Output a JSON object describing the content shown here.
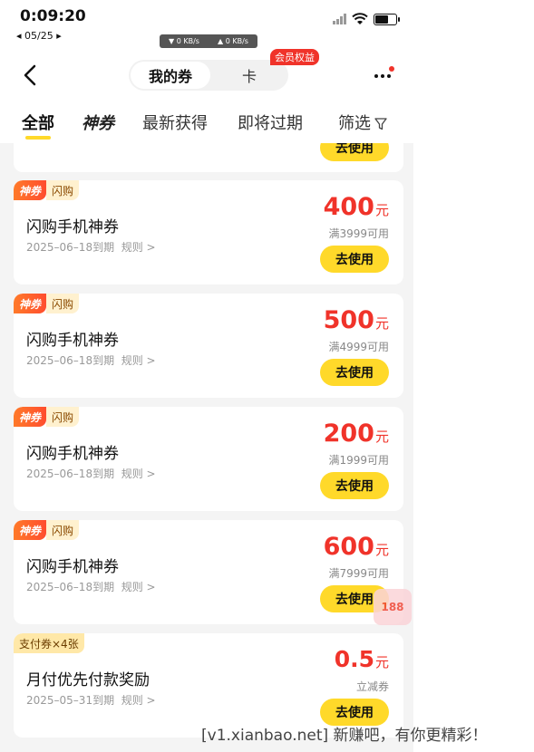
{
  "status_bar": {
    "time": "0:09:20",
    "back_app": "◂ 05/25 ▸",
    "net_down": "▼ 0 KB/s",
    "net_up": "▲ 0 KB/s"
  },
  "nav": {
    "tab_coupons": "我的券",
    "tab_cards": "卡",
    "member_badge": "会员权益"
  },
  "tabs": {
    "all": "全部",
    "shen": "神券",
    "latest": "最新获得",
    "expiring": "即将过期",
    "filter": "筛选"
  },
  "cards": [
    {
      "btn": "去使用"
    },
    {
      "tag1": "神券",
      "tag2": "闪购",
      "title": "闪购手机神券",
      "expiry": "2025–06–18到期",
      "rule": "规则 >",
      "amount": "400",
      "unit": "元",
      "cond": "满3999可用",
      "btn": "去使用"
    },
    {
      "tag1": "神券",
      "tag2": "闪购",
      "title": "闪购手机神券",
      "expiry": "2025–06–18到期",
      "rule": "规则 >",
      "amount": "500",
      "unit": "元",
      "cond": "满4999可用",
      "btn": "去使用"
    },
    {
      "tag1": "神券",
      "tag2": "闪购",
      "title": "闪购手机神券",
      "expiry": "2025–06–18到期",
      "rule": "规则 >",
      "amount": "200",
      "unit": "元",
      "cond": "满1999可用",
      "btn": "去使用"
    },
    {
      "tag1": "神券",
      "tag2": "闪购",
      "title": "闪购手机神券",
      "expiry": "2025–06–18到期",
      "rule": "规则 >",
      "amount": "600",
      "unit": "元",
      "cond": "满7999可用",
      "btn": "去使用"
    },
    {
      "tag1": "支付券×4张",
      "title": "月付优先付款奖励",
      "expiry": "2025–05–31到期",
      "rule": "规则 >",
      "amount": "0.5",
      "unit": "元",
      "cond": "立减券",
      "btn": "去使用"
    }
  ],
  "float_badge": "188",
  "watermark": "[v1.xianbao.net] 新赚吧，有你更精彩！",
  "colors": {
    "accent_yellow": "#ffd92a",
    "price_red": "#f0332a",
    "shen_orange": "#ff5a2c"
  }
}
